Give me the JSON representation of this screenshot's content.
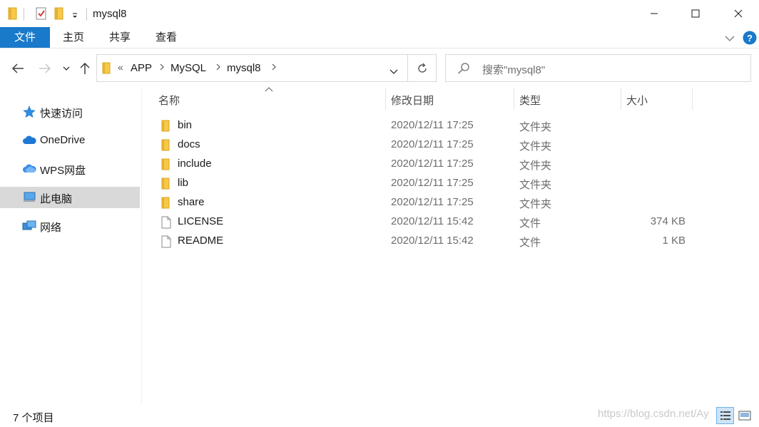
{
  "window": {
    "title": "mysql8"
  },
  "ribbon": {
    "tabs": [
      "文件",
      "主页",
      "共享",
      "查看"
    ],
    "help_label": "?"
  },
  "address": {
    "overflow": "«",
    "crumbs": [
      "APP",
      "MySQL",
      "mysql8"
    ],
    "search_placeholder": "搜索\"mysql8\""
  },
  "sidebar": {
    "items": [
      {
        "label": "快速访问",
        "icon": "star-icon"
      },
      {
        "label": "OneDrive",
        "icon": "cloud-icon"
      },
      {
        "label": "WPS网盘",
        "icon": "wps-cloud-icon"
      },
      {
        "label": "此电脑",
        "icon": "computer-icon",
        "selected": true
      },
      {
        "label": "网络",
        "icon": "network-icon"
      }
    ]
  },
  "columns": {
    "name": "名称",
    "date": "修改日期",
    "type": "类型",
    "size": "大小"
  },
  "files": [
    {
      "name": "bin",
      "date": "2020/12/11 17:25",
      "type": "文件夹",
      "size": "",
      "icon": "folder-icon"
    },
    {
      "name": "docs",
      "date": "2020/12/11 17:25",
      "type": "文件夹",
      "size": "",
      "icon": "folder-icon"
    },
    {
      "name": "include",
      "date": "2020/12/11 17:25",
      "type": "文件夹",
      "size": "",
      "icon": "folder-icon"
    },
    {
      "name": "lib",
      "date": "2020/12/11 17:25",
      "type": "文件夹",
      "size": "",
      "icon": "folder-icon"
    },
    {
      "name": "share",
      "date": "2020/12/11 17:25",
      "type": "文件夹",
      "size": "",
      "icon": "folder-icon"
    },
    {
      "name": "LICENSE",
      "date": "2020/12/11 15:42",
      "type": "文件",
      "size": "374 KB",
      "icon": "file-icon"
    },
    {
      "name": "README",
      "date": "2020/12/11 15:42",
      "type": "文件",
      "size": "1 KB",
      "icon": "file-icon"
    }
  ],
  "status": {
    "item_count": "7 个项目",
    "watermark": "https://blog.csdn.net/Ay"
  },
  "colors": {
    "accent": "#1979ca",
    "folder": "#f7c948",
    "selected": "#d9d9d9"
  }
}
